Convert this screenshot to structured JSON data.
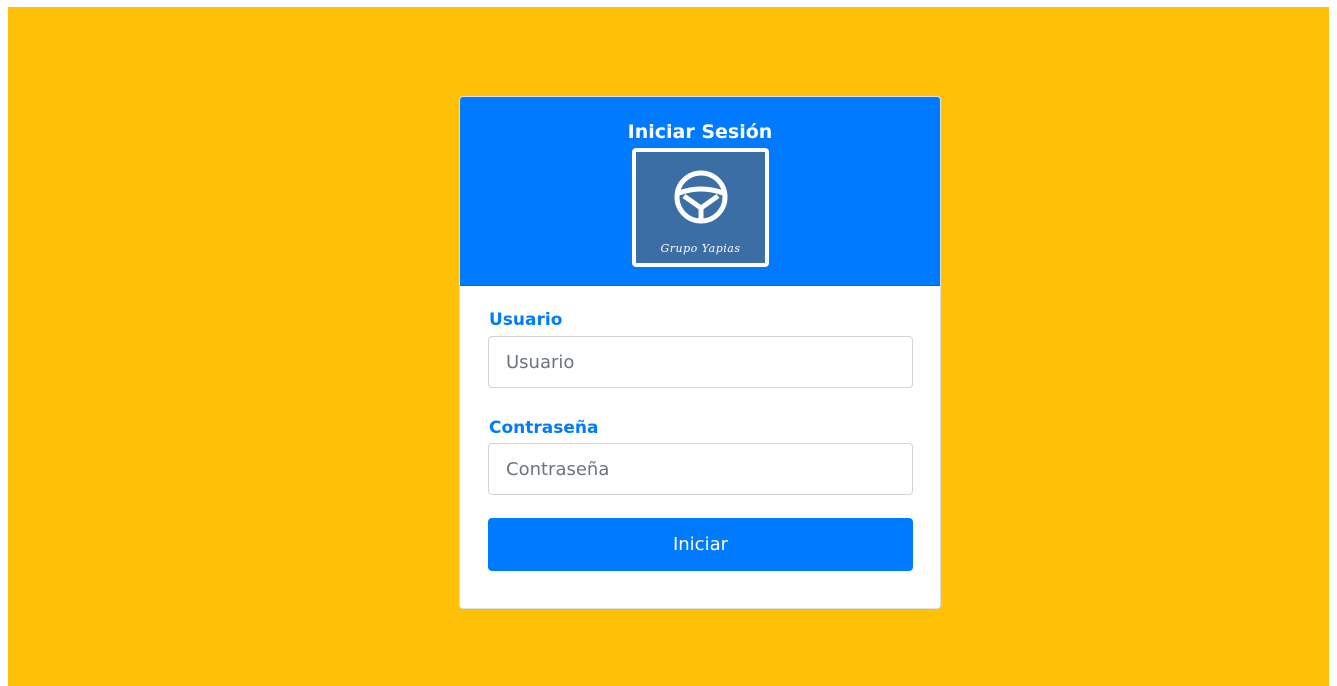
{
  "header": {
    "title": "Iniciar Sesión",
    "logo_icon": "steering-wheel-icon",
    "logo_text": "Grupo Yapias"
  },
  "form": {
    "username": {
      "label": "Usuario",
      "placeholder": "Usuario",
      "value": ""
    },
    "password": {
      "label": "Contraseña",
      "placeholder": "Contraseña",
      "value": ""
    },
    "submit_label": "Iniciar"
  },
  "colors": {
    "background": "#ffc107",
    "primary": "#007bff",
    "logo_bg": "#3a6ea5"
  }
}
